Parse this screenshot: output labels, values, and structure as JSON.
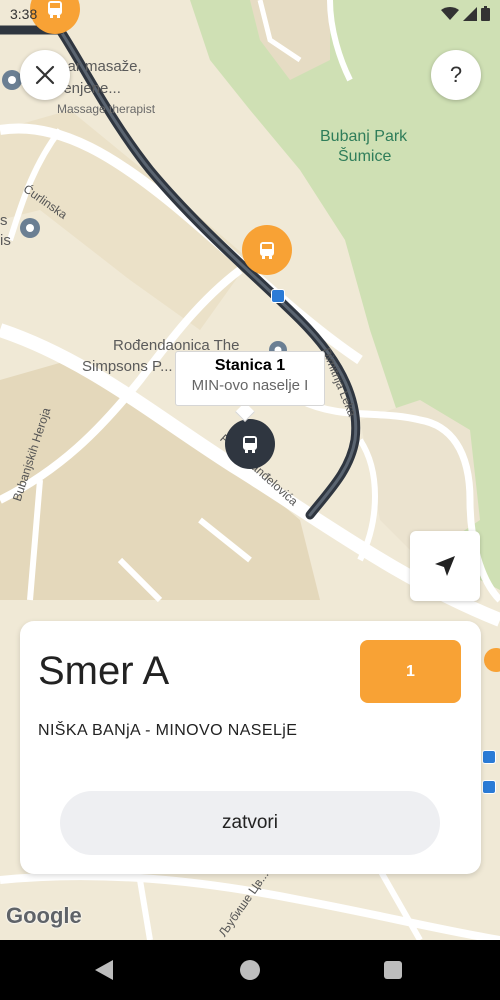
{
  "status_bar": {
    "time": "3:38"
  },
  "map": {
    "labels": {
      "massage_line1": "zar masaže,",
      "massage_line2": "lenjene...",
      "massage_sub": "Massage therapist",
      "park_line1": "Bubanj Park",
      "park_line2": "Šumice",
      "curlinska": "Ćurlinska",
      "left_clip_1": "s",
      "left_clip_2": "is",
      "birthday_line1": "Rođendaonica The",
      "birthday_line2": "Simpsons P...",
      "dimitrija": "Dimitrija Leka",
      "heroja": "Bubanjskih Heroja",
      "andjelovica": "Pavla Ranđelovića",
      "cyrillic_street": "Љубише Цв..."
    },
    "google": "Google"
  },
  "callout": {
    "title": "Stanica 1",
    "subtitle": "MIN-ovo naselje I"
  },
  "buttons": {
    "help": "?"
  },
  "sheet": {
    "title": "Smer A",
    "badge": "1",
    "route": "NIŠKA BANjA - MINOVO NASELjE",
    "close_label": "zatvori"
  },
  "colors": {
    "accent": "#f8a235",
    "route_line": "#2f3640",
    "park": "#cfe0b4",
    "stop_sign": "#2b7bd6"
  }
}
